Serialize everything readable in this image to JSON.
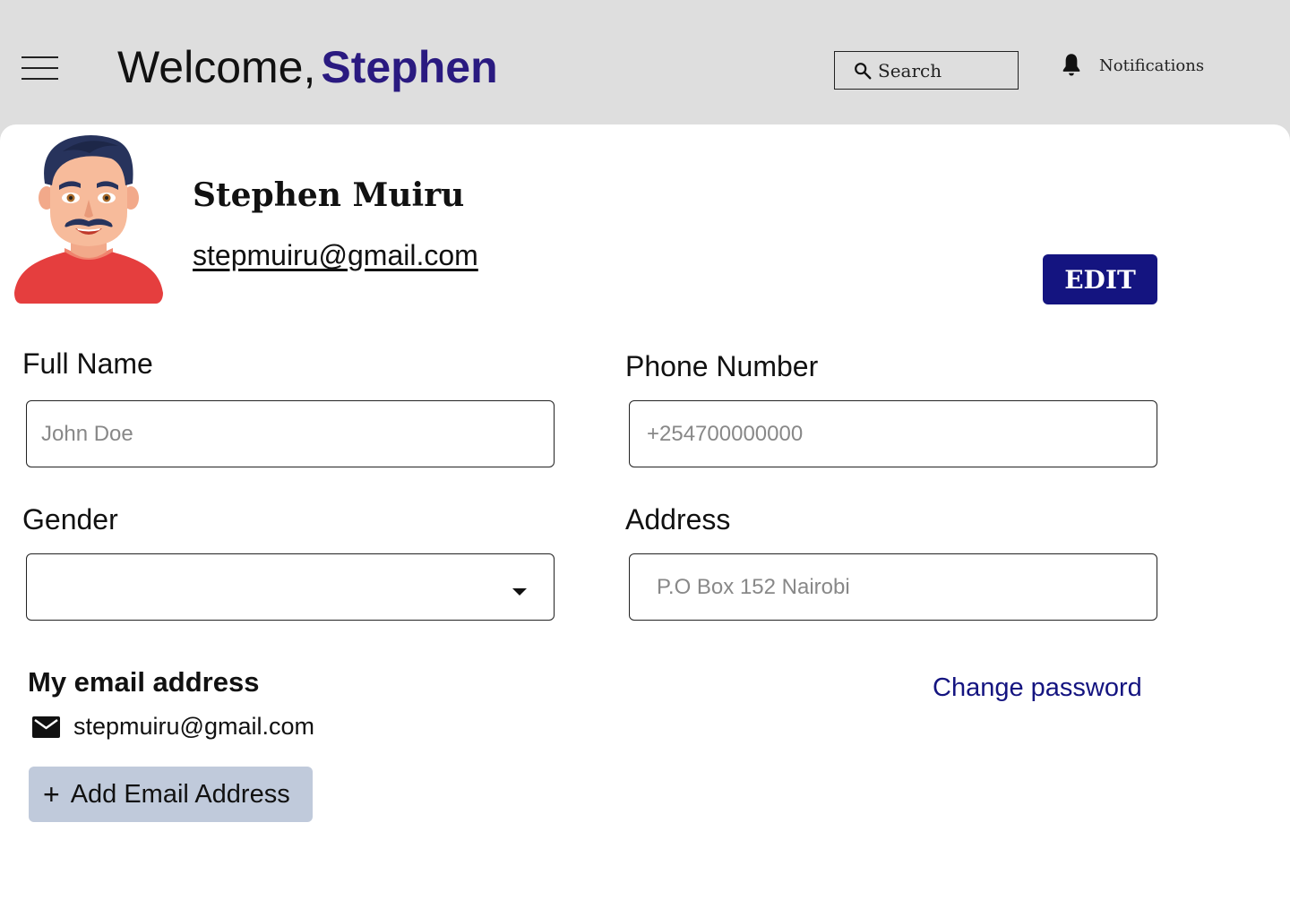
{
  "header": {
    "greeting": "Welcome,",
    "user_first_name": "Stephen",
    "search_label": "Search",
    "notifications_label": "Notifications"
  },
  "profile": {
    "full_name": "Stephen Muiru",
    "email": "stepmuiru@gmail.com",
    "edit_label": "EDIT"
  },
  "form": {
    "full_name": {
      "label": "Full Name",
      "placeholder": "John Doe"
    },
    "phone": {
      "label": "Phone Number",
      "placeholder": "+254700000000"
    },
    "gender": {
      "label": "Gender",
      "value": ""
    },
    "address": {
      "label": "Address",
      "placeholder": "P.O Box 152 Nairobi"
    }
  },
  "email_section": {
    "title": "My email address",
    "emails": [
      "stepmuiru@gmail.com"
    ],
    "add_label": "Add Email Address",
    "add_icon": "plus-icon"
  },
  "change_password_label": "Change password",
  "icons": [
    "menu-icon",
    "search-icon",
    "bell-icon",
    "mail-icon",
    "plus-icon",
    "chevron-down-icon"
  ],
  "colors": {
    "header_bg": "#dedede",
    "accent_name": "#2a1a80",
    "primary_button": "#141480",
    "link": "#141480",
    "add_button_bg": "#c0cadb",
    "avatar_shirt": "#e53e3e"
  }
}
